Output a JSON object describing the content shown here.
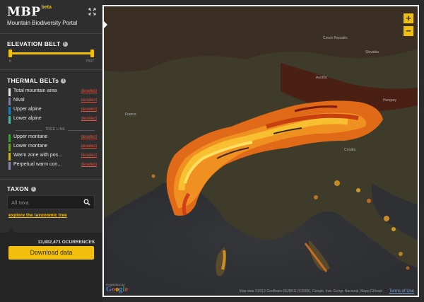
{
  "brand": {
    "logo": "MBP",
    "badge": "beta",
    "subtitle": "Mountain Biodiversity Portal"
  },
  "elevation": {
    "title": "ELEVATION BELT",
    "min_label": "0",
    "max_label": "7597"
  },
  "thermal": {
    "title": "THERMAL BELTs",
    "tree_line_label": "TREE LINE",
    "items": [
      {
        "label": "Total mountain area",
        "action": "deselect",
        "color": "#e6e6e6"
      },
      {
        "label": "Nival",
        "action": "deselect",
        "color": "#7c7c9c"
      },
      {
        "label": "Upper alpine",
        "action": "deselect",
        "color": "#1e7fb8"
      },
      {
        "label": "Lower alpine",
        "action": "deselect",
        "color": "#4fb2a4"
      },
      {
        "label": "Upper montane",
        "action": "deselect",
        "color": "#3f9a3a"
      },
      {
        "label": "Lower montane",
        "action": "deselect",
        "color": "#6d9a2e"
      },
      {
        "label": "Warm zone with pos...",
        "action": "deselect",
        "color": "#c9b42a"
      },
      {
        "label": "Perpetual warm con...",
        "action": "deselect",
        "color": "#8a8aa8"
      }
    ]
  },
  "taxon": {
    "title": "TAXON",
    "placeholder": "All taxa",
    "link": "explore the taxonomic tree"
  },
  "footer": {
    "occurrences": "13,802,471 OCURRENCES",
    "download_label": "Download data"
  },
  "map": {
    "zoom_in": "+",
    "zoom_out": "−",
    "powered_by": "POWERED BY",
    "google_letters": [
      "G",
      "o",
      "o",
      "g",
      "l",
      "e"
    ],
    "google_colors": [
      "#4a7fd8",
      "#d34a3a",
      "#e8b422",
      "#4a7fd8",
      "#3e9a48",
      "#d34a3a"
    ],
    "attribution": "Map data ©2013 GeoBasis-DE/BKG (©2009), Google, Inst. Geogr. Nacional, Mapa GISrael",
    "terms": "Terms of Use",
    "labels": [
      {
        "text": "Czech Republic"
      },
      {
        "text": "Slovakia"
      },
      {
        "text": "Austria"
      },
      {
        "text": "Hungary"
      },
      {
        "text": "Croatia"
      },
      {
        "text": "France"
      }
    ]
  },
  "colors": {
    "accent": "#f2c00c",
    "deselect": "#e0503a",
    "sidebar": "#2e2e2e"
  }
}
